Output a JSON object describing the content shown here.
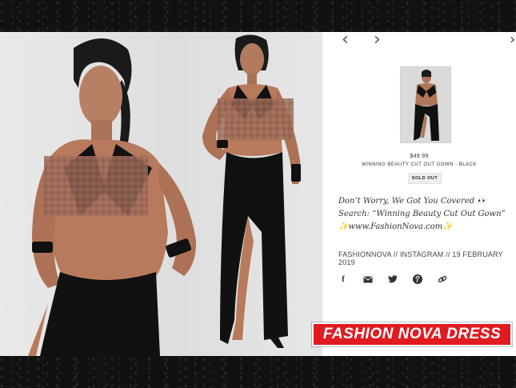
{
  "product": {
    "price": "$49.99",
    "name": "WINNING BEAUTY CUT OUT GOWN - BLACK",
    "status_badge": "SOLD OUT"
  },
  "post": {
    "caption_lines": [
      "Don’t Worry, We Got You Covered 👀",
      "Search: “Winning Beauty Cut Out Gown”",
      "✨www.FashionNova.com✨"
    ],
    "meta": "FASHIONNOVA // INSTAGRAM // 19 FEBRUARY 2019"
  },
  "navigation": {
    "prev_icon": "chevron-left-icon",
    "next_icon": "chevron-right-icon",
    "edge_icon": "chevron-right-icon"
  },
  "share_icons": [
    "facebook-icon",
    "email-icon",
    "twitter-icon",
    "pinterest-icon",
    "link-icon"
  ],
  "banner": {
    "text": "FASHION NOVA DRESS"
  },
  "colors": {
    "banner_red": "#e01b22",
    "dress_black": "#111111"
  }
}
